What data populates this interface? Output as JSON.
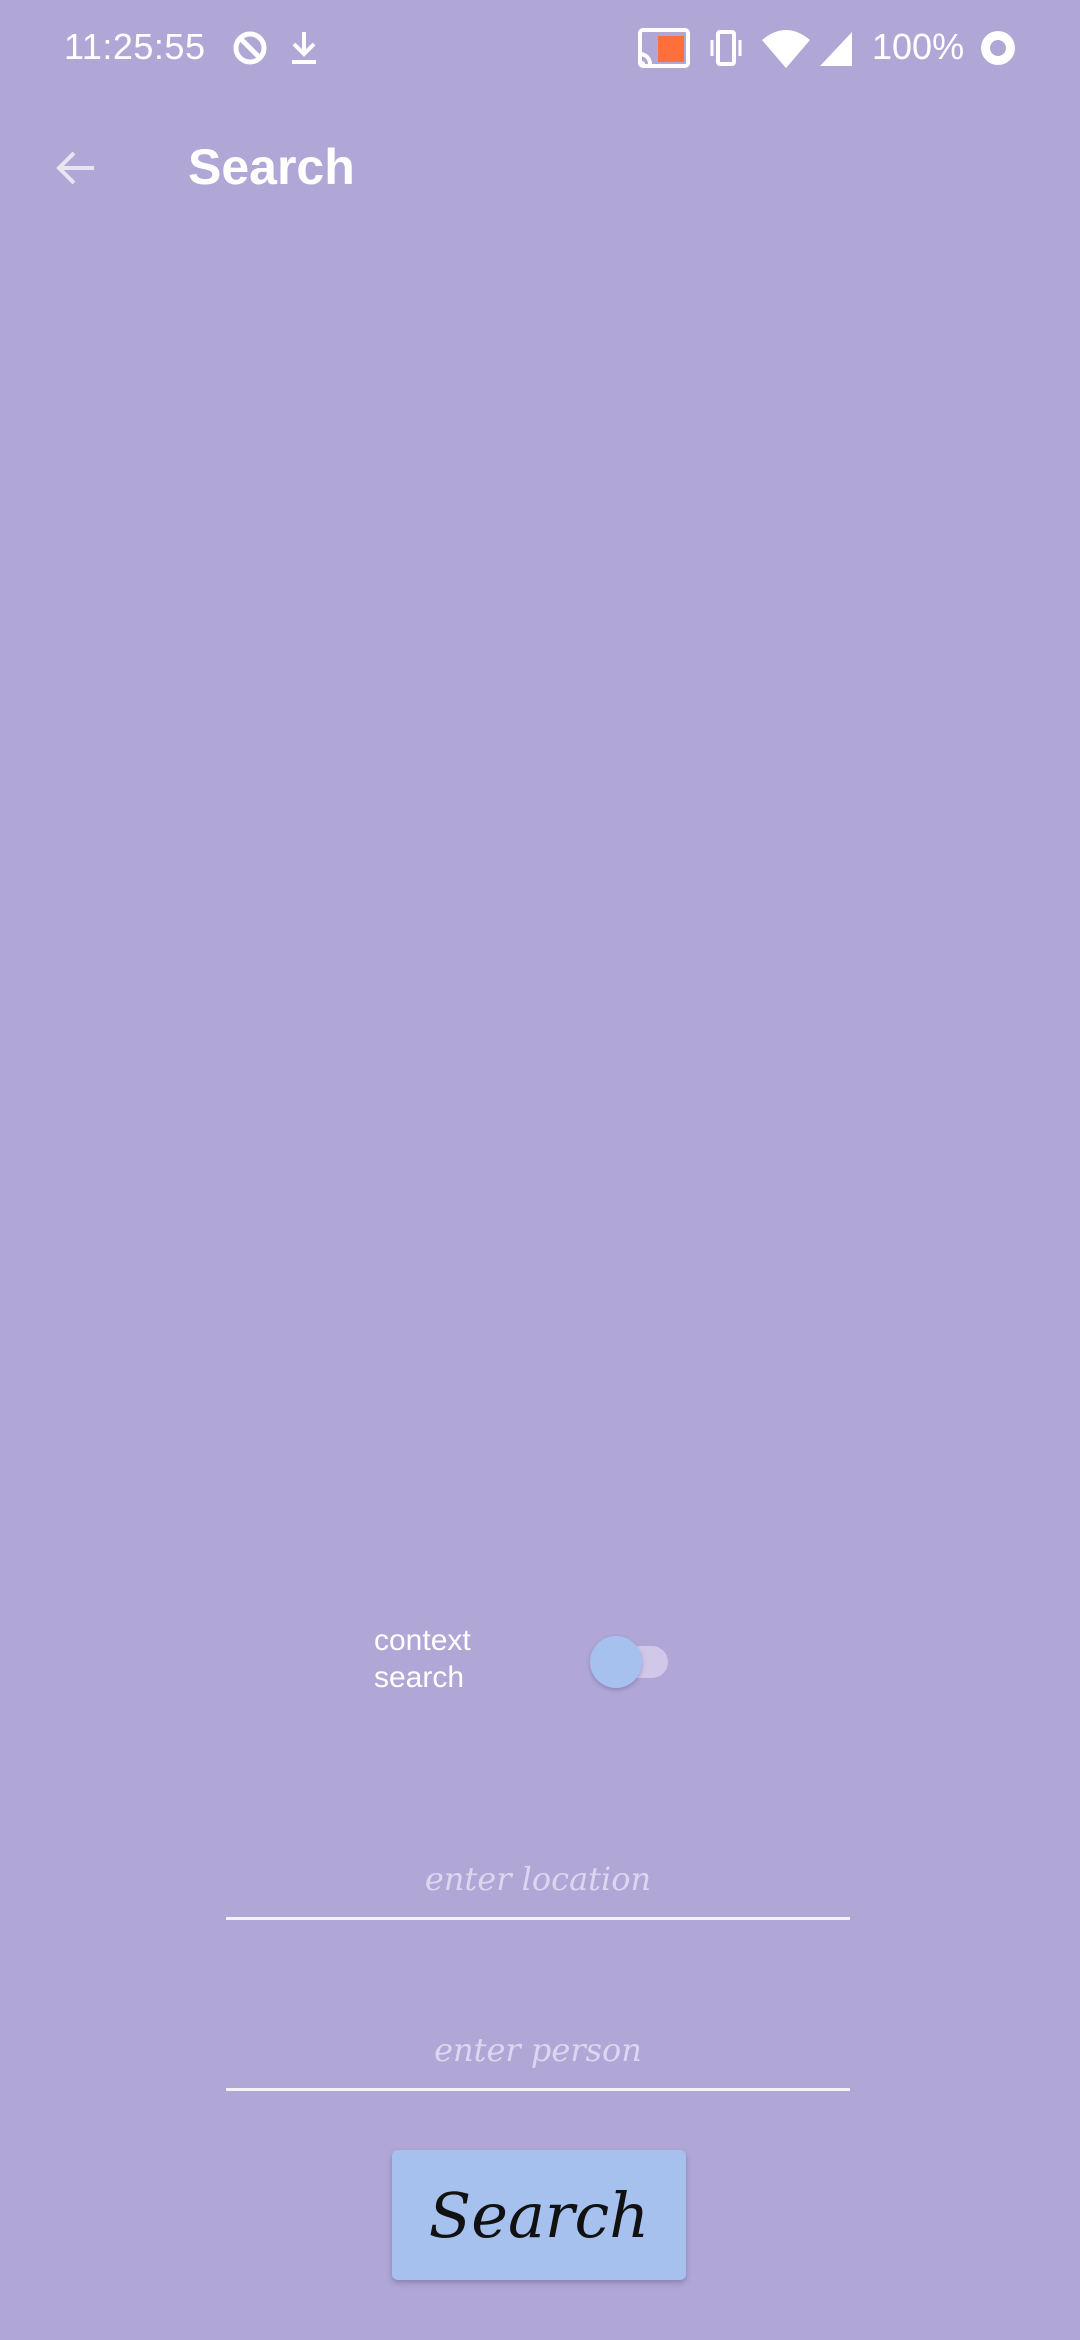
{
  "status_bar": {
    "time": "11:25:55",
    "battery_text": "100%",
    "icons": [
      "data-saver-icon",
      "download-icon",
      "cast-icon",
      "vibrate-icon",
      "wifi-icon",
      "signal-icon",
      "battery-saver-icon"
    ],
    "cast_accent": "#ff6f3c"
  },
  "app_bar": {
    "back_icon": "arrow-back-icon",
    "title": "Search"
  },
  "context_search": {
    "label": "context search",
    "enabled": false
  },
  "location": {
    "placeholder": "enter location",
    "value": ""
  },
  "person": {
    "placeholder": "enter person",
    "value": ""
  },
  "search_button": {
    "label": "Search"
  },
  "colors": {
    "background": "#b1a7d6",
    "button": "#a6c1ee",
    "toggle_thumb": "#a6c1ee"
  }
}
